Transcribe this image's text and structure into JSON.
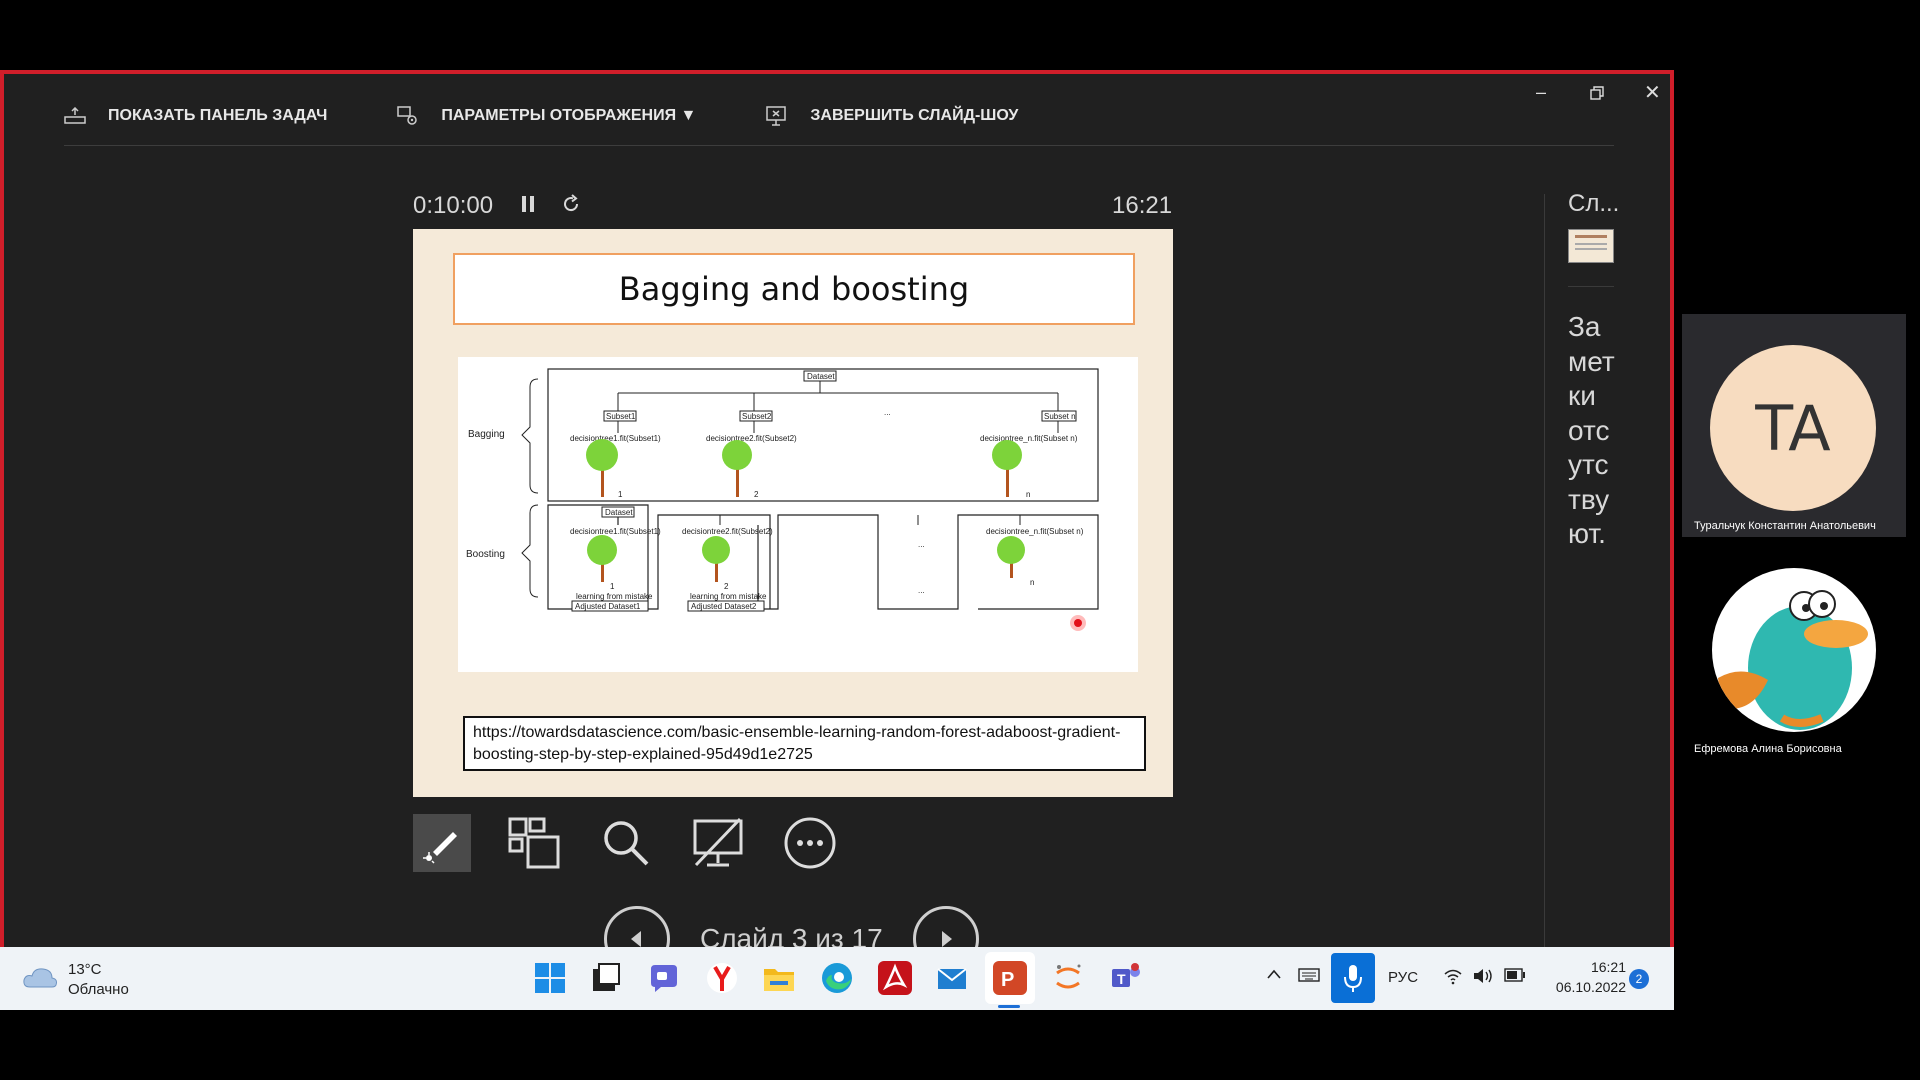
{
  "toolbar": {
    "show_taskbar": "ПОКАЗАТЬ ПАНЕЛЬ ЗАДАЧ",
    "display_settings": "ПАРАМЕТРЫ ОТОБРАЖЕНИЯ ▼",
    "end_slideshow": "ЗАВЕРШИТЬ СЛАЙД-ШОУ"
  },
  "timer": "0:10:00",
  "clock": "16:21",
  "slide": {
    "title": "Bagging and boosting",
    "diagram": {
      "bagging_label": "Bagging",
      "boosting_label": "Boosting",
      "dataset": "Dataset",
      "subset1": "Subset1",
      "subset2": "Subset2",
      "subsetn": "Subset n",
      "dots": "...",
      "fit1": "decisiontree1.fit(Subset1)",
      "fit2": "decisiontree2.fit(Subset2)",
      "fitn": "decisiontree_n.fit(Subset n)",
      "n1": "1",
      "n2": "2",
      "nn": "n",
      "learning": "learning from mistake",
      "adjusted1": "Adjusted Dataset1",
      "adjusted2": "Adjusted Dataset2"
    },
    "url": "https://towardsdatascience.com/basic-ensemble-learning-random-forest-adaboost-gradient-boosting-step-by-step-explained-95d49d1e2725"
  },
  "navigation": {
    "slide_counter": "Слайд 3 из 17"
  },
  "notes": {
    "title": "Сл...",
    "text": "Заметки отсутствуют."
  },
  "participants": [
    {
      "initials": "TA",
      "name": "Туральчук Константин Анатольевич"
    },
    {
      "name": "Ефремова Алина Борисовна"
    }
  ],
  "taskbar": {
    "weather_temp": "13°C",
    "weather_desc": "Облачно",
    "language": "РУС",
    "time": "16:21",
    "date": "06.10.2022",
    "notifications": "2"
  },
  "colors": {
    "frame_border": "#d01e2a",
    "slide_bg": "#f5ead9",
    "title_border": "#f0a060",
    "mic_active": "#0a6fd6"
  }
}
